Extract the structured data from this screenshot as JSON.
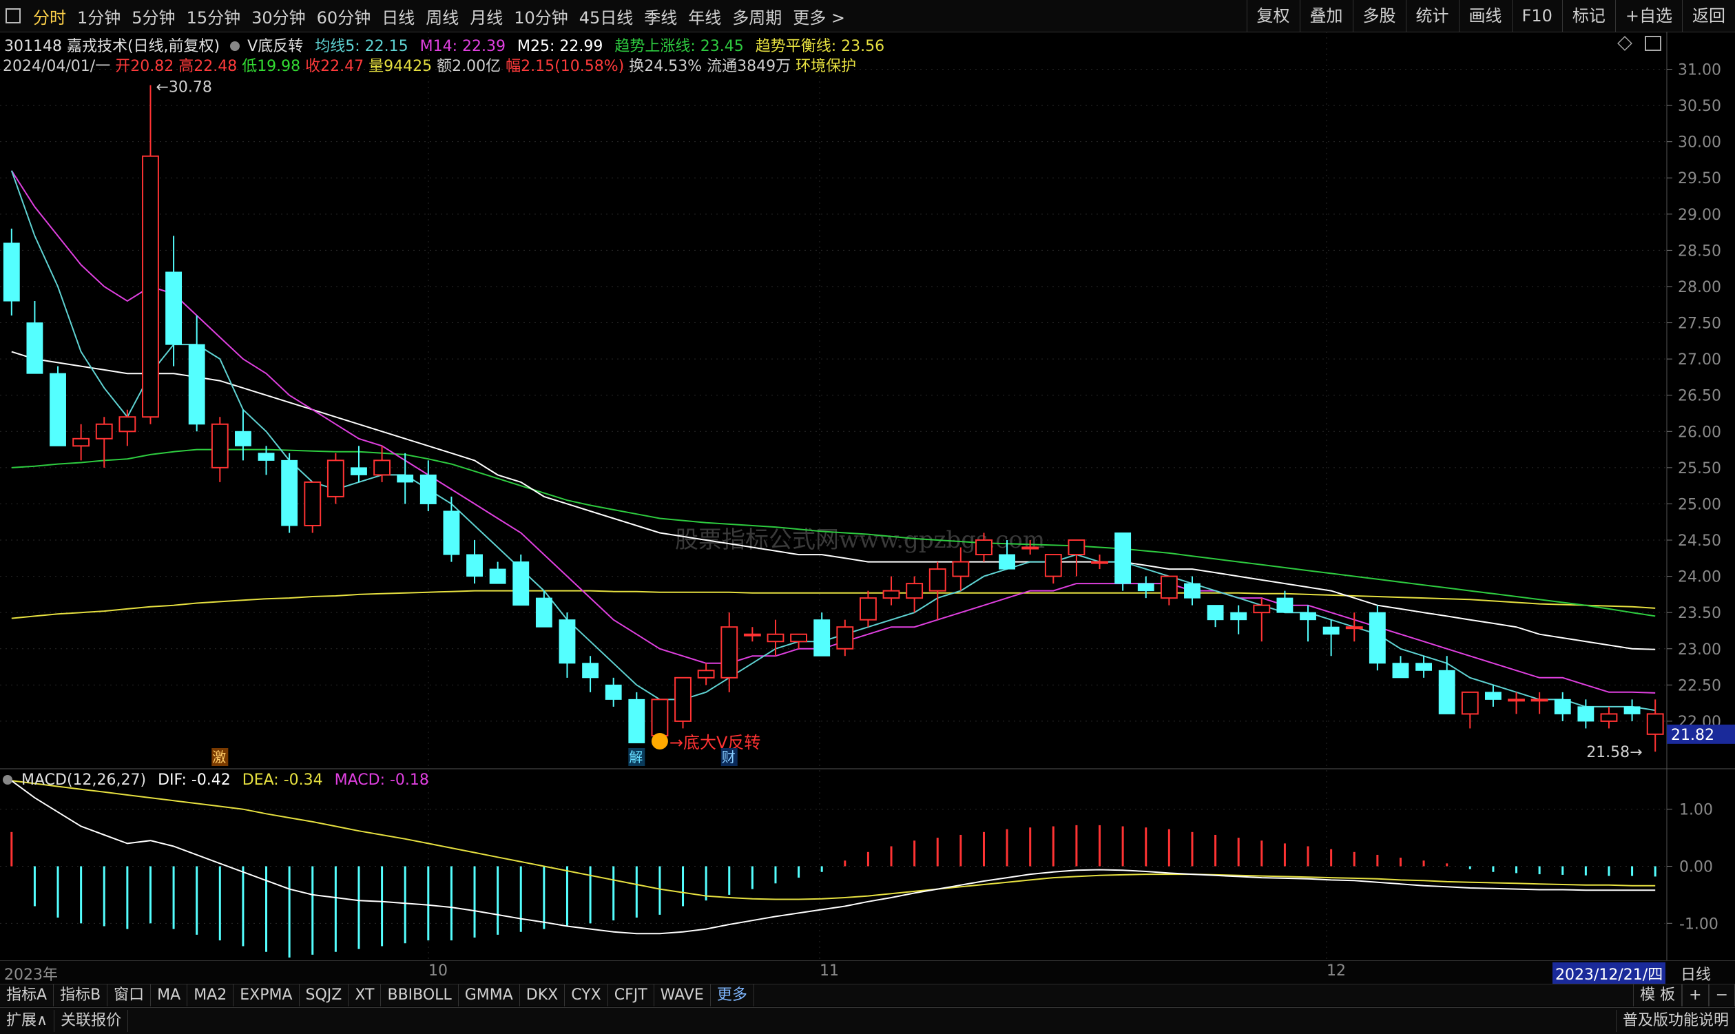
{
  "toolbar": {
    "periods": [
      "分时",
      "1分钟",
      "5分钟",
      "15分钟",
      "30分钟",
      "60分钟",
      "日线",
      "周线",
      "月线",
      "10分钟",
      "45日线",
      "季线",
      "年线",
      "多周期",
      "更多 >"
    ],
    "active_period": "分时",
    "right_buttons": [
      "复权",
      "叠加",
      "多股",
      "统计",
      "画线",
      "F10",
      "标记",
      "+自选",
      "返回"
    ]
  },
  "header": {
    "code_name": "301148 嘉戎技术(日线,前复权)",
    "indicator": "V底反转",
    "ma5": "均线5: 22.15",
    "m14": "M14: 22.39",
    "m25": "M25: 22.99",
    "trend_up": "趋势上涨线: 23.45",
    "trend_bal": "趋势平衡线: 23.56"
  },
  "stats": {
    "date": "2024/04/01/一",
    "open": "开20.82",
    "high": "高22.48",
    "low": "低19.98",
    "close": "收22.47",
    "volume": "量94425",
    "amount": "额2.00亿",
    "change": "幅2.15(10.58%)",
    "turnover": "换24.53%",
    "float": "流通3849万",
    "env": "环境保护"
  },
  "colors": {
    "up": "#ff3333",
    "down": "#54ffff",
    "ma5": "#5fd3d3",
    "m14": "#e040e0",
    "m25": "#ffffff",
    "trend_up": "#2ecc40",
    "trend_bal": "#e6e040",
    "dif": "#ffffff",
    "dea": "#e6e040"
  },
  "annotations": {
    "high_label": "30.78",
    "low_label": "21.58",
    "last_price": "21.82",
    "signal": "→底大V反转",
    "tag_ji": "激",
    "tag_jie": "解",
    "tag_cai": "财",
    "watermark": "股票指标公式网www.gpzbgs.com"
  },
  "macd": {
    "title": "MACD(12,26,27)",
    "dif": "DIF: -0.42",
    "dea": "DEA: -0.34",
    "macd": "MACD: -0.18"
  },
  "time_axis": {
    "labels": [
      "2023年",
      "10",
      "11",
      "12"
    ],
    "current": "2023/12/21/四",
    "period": "日线"
  },
  "bottom_tabs": [
    "指标A",
    "指标B",
    "窗口",
    "MA",
    "MA2",
    "EXPMA",
    "SQJZ",
    "XT",
    "BBIBOLL",
    "GMMA",
    "DKX",
    "CYX",
    "CFJT",
    "WAVE",
    "更多"
  ],
  "bottom_right": [
    "模 板",
    "+",
    "−"
  ],
  "footer": {
    "expand": "扩展∧",
    "quote": "关联报价",
    "right": "普及版功能说明"
  },
  "chart_data": {
    "type": "candlestick",
    "price_ticks": [
      "31.00",
      "30.50",
      "30.00",
      "29.50",
      "29.00",
      "28.50",
      "28.00",
      "27.50",
      "27.00",
      "26.50",
      "26.00",
      "25.50",
      "25.00",
      "24.50",
      "24.00",
      "23.50",
      "23.00",
      "22.50",
      "22.00"
    ],
    "ylim": [
      21.4,
      31.1
    ],
    "macd_ticks": [
      "1.00",
      "0.00",
      "-1.00"
    ],
    "macd_ylim": [
      -1.6,
      1.6
    ],
    "ohlc": [
      [
        28.6,
        28.8,
        27.6,
        27.8
      ],
      [
        27.5,
        27.8,
        26.8,
        26.8
      ],
      [
        26.8,
        26.9,
        25.8,
        25.8
      ],
      [
        25.8,
        26.1,
        25.6,
        25.9
      ],
      [
        25.9,
        26.2,
        25.5,
        26.1
      ],
      [
        26.0,
        26.3,
        25.8,
        26.2
      ],
      [
        26.2,
        30.78,
        26.1,
        29.8
      ],
      [
        28.2,
        28.7,
        26.9,
        27.2
      ],
      [
        27.2,
        27.6,
        26.0,
        26.1
      ],
      [
        25.5,
        26.2,
        25.3,
        26.1
      ],
      [
        26.0,
        26.3,
        25.6,
        25.8
      ],
      [
        25.7,
        25.8,
        25.4,
        25.6
      ],
      [
        25.6,
        25.7,
        24.6,
        24.7
      ],
      [
        24.7,
        25.3,
        24.6,
        25.3
      ],
      [
        25.1,
        25.7,
        25.0,
        25.6
      ],
      [
        25.5,
        25.8,
        25.3,
        25.4
      ],
      [
        25.4,
        25.8,
        25.3,
        25.6
      ],
      [
        25.4,
        25.7,
        25.0,
        25.3
      ],
      [
        25.4,
        25.6,
        24.9,
        25.0
      ],
      [
        24.9,
        25.1,
        24.2,
        24.3
      ],
      [
        24.3,
        24.5,
        23.9,
        24.0
      ],
      [
        24.1,
        24.2,
        23.9,
        23.9
      ],
      [
        24.2,
        24.3,
        23.6,
        23.6
      ],
      [
        23.7,
        23.8,
        23.3,
        23.3
      ],
      [
        23.4,
        23.5,
        22.6,
        22.8
      ],
      [
        22.8,
        22.9,
        22.4,
        22.6
      ],
      [
        22.5,
        22.6,
        22.2,
        22.3
      ],
      [
        22.3,
        22.4,
        21.7,
        21.7
      ],
      [
        21.8,
        22.3,
        21.8,
        22.3
      ],
      [
        22.0,
        22.6,
        21.9,
        22.6
      ],
      [
        22.6,
        22.8,
        22.5,
        22.7
      ],
      [
        22.6,
        23.5,
        22.4,
        23.3
      ],
      [
        23.2,
        23.3,
        23.1,
        23.2
      ],
      [
        23.1,
        23.4,
        22.9,
        23.2
      ],
      [
        23.1,
        23.2,
        23.0,
        23.2
      ],
      [
        23.4,
        23.5,
        22.9,
        22.9
      ],
      [
        23.0,
        23.4,
        22.9,
        23.3
      ],
      [
        23.4,
        23.8,
        23.3,
        23.7
      ],
      [
        23.7,
        24.0,
        23.6,
        23.8
      ],
      [
        23.7,
        24.0,
        23.5,
        23.9
      ],
      [
        23.8,
        24.2,
        23.4,
        24.1
      ],
      [
        24.0,
        24.4,
        23.8,
        24.2
      ],
      [
        24.3,
        24.6,
        24.2,
        24.5
      ],
      [
        24.3,
        24.5,
        24.1,
        24.1
      ],
      [
        24.4,
        24.5,
        24.3,
        24.4
      ],
      [
        24.0,
        24.2,
        23.9,
        24.3
      ],
      [
        24.3,
        24.5,
        24.0,
        24.5
      ],
      [
        24.2,
        24.3,
        24.1,
        24.2
      ],
      [
        24.6,
        24.6,
        23.8,
        23.9
      ],
      [
        23.9,
        24.0,
        23.7,
        23.8
      ],
      [
        23.7,
        24.0,
        23.6,
        24.0
      ],
      [
        23.9,
        24.0,
        23.6,
        23.7
      ],
      [
        23.6,
        23.6,
        23.3,
        23.4
      ],
      [
        23.5,
        23.6,
        23.2,
        23.4
      ],
      [
        23.5,
        23.7,
        23.1,
        23.6
      ],
      [
        23.7,
        23.8,
        23.5,
        23.5
      ],
      [
        23.5,
        23.6,
        23.1,
        23.4
      ],
      [
        23.3,
        23.4,
        22.9,
        23.2
      ],
      [
        23.3,
        23.5,
        23.1,
        23.3
      ],
      [
        23.5,
        23.6,
        22.7,
        22.8
      ],
      [
        22.8,
        22.9,
        22.6,
        22.6
      ],
      [
        22.8,
        22.9,
        22.6,
        22.7
      ],
      [
        22.7,
        22.9,
        22.1,
        22.1
      ],
      [
        22.1,
        22.4,
        21.9,
        22.4
      ],
      [
        22.4,
        22.5,
        22.2,
        22.3
      ],
      [
        22.3,
        22.4,
        22.1,
        22.3
      ],
      [
        22.3,
        22.4,
        22.1,
        22.3
      ],
      [
        22.3,
        22.4,
        22.0,
        22.1
      ],
      [
        22.2,
        22.3,
        21.9,
        22.0
      ],
      [
        22.0,
        22.2,
        21.9,
        22.1
      ],
      [
        22.2,
        22.3,
        22.0,
        22.1
      ],
      [
        21.82,
        22.3,
        21.58,
        22.1
      ]
    ],
    "ma5": [
      29.6,
      28.7,
      28.0,
      27.1,
      26.6,
      26.2,
      26.8,
      27.2,
      27.2,
      27.0,
      26.3,
      26.0,
      25.6,
      25.3,
      25.2,
      25.3,
      25.4,
      25.4,
      25.2,
      25.0,
      24.7,
      24.4,
      24.1,
      23.8,
      23.4,
      23.1,
      22.8,
      22.5,
      22.3,
      22.3,
      22.4,
      22.6,
      22.8,
      23.0,
      23.1,
      23.1,
      23.2,
      23.3,
      23.4,
      23.5,
      23.7,
      23.8,
      24.0,
      24.1,
      24.2,
      24.2,
      24.3,
      24.2,
      24.2,
      24.1,
      24.0,
      23.9,
      23.8,
      23.7,
      23.6,
      23.5,
      23.5,
      23.4,
      23.3,
      23.2,
      23.0,
      22.9,
      22.8,
      22.6,
      22.5,
      22.4,
      22.3,
      22.3,
      22.2,
      22.2,
      22.2,
      22.15
    ],
    "m14": [
      29.6,
      29.1,
      28.7,
      28.3,
      28.0,
      27.8,
      28.0,
      27.9,
      27.6,
      27.3,
      27.0,
      26.8,
      26.5,
      26.3,
      26.1,
      25.9,
      25.8,
      25.6,
      25.4,
      25.2,
      25.0,
      24.8,
      24.6,
      24.3,
      24.0,
      23.7,
      23.4,
      23.2,
      23.0,
      22.9,
      22.8,
      22.8,
      22.9,
      22.9,
      23.0,
      23.0,
      23.1,
      23.2,
      23.3,
      23.3,
      23.4,
      23.5,
      23.6,
      23.7,
      23.8,
      23.8,
      23.9,
      23.9,
      23.9,
      23.9,
      23.9,
      23.8,
      23.8,
      23.7,
      23.7,
      23.6,
      23.6,
      23.5,
      23.4,
      23.3,
      23.2,
      23.1,
      23.0,
      22.9,
      22.8,
      22.7,
      22.6,
      22.6,
      22.5,
      22.4,
      22.4,
      22.39
    ],
    "m25": [
      27.1,
      27.0,
      26.95,
      26.9,
      26.85,
      26.8,
      26.8,
      26.8,
      26.75,
      26.7,
      26.6,
      26.5,
      26.4,
      26.3,
      26.2,
      26.1,
      26.0,
      25.9,
      25.8,
      25.7,
      25.6,
      25.4,
      25.3,
      25.1,
      25.0,
      24.9,
      24.8,
      24.7,
      24.6,
      24.55,
      24.5,
      24.45,
      24.4,
      24.35,
      24.3,
      24.3,
      24.25,
      24.2,
      24.2,
      24.2,
      24.2,
      24.2,
      24.2,
      24.2,
      24.2,
      24.2,
      24.2,
      24.2,
      24.2,
      24.15,
      24.1,
      24.1,
      24.05,
      24.0,
      23.95,
      23.9,
      23.85,
      23.8,
      23.7,
      23.6,
      23.55,
      23.5,
      23.45,
      23.4,
      23.35,
      23.3,
      23.2,
      23.15,
      23.1,
      23.05,
      23.0,
      22.99
    ],
    "trend_up": [
      25.5,
      25.52,
      25.55,
      25.57,
      25.6,
      25.62,
      25.68,
      25.72,
      25.75,
      25.75,
      25.75,
      25.75,
      25.74,
      25.73,
      25.72,
      25.72,
      25.7,
      25.68,
      25.62,
      25.55,
      25.45,
      25.35,
      25.25,
      25.15,
      25.05,
      24.98,
      24.92,
      24.86,
      24.8,
      24.77,
      24.74,
      24.72,
      24.7,
      24.68,
      24.65,
      24.62,
      24.6,
      24.58,
      24.55,
      24.52,
      24.5,
      24.48,
      24.46,
      24.45,
      24.44,
      24.43,
      24.42,
      24.4,
      24.38,
      24.35,
      24.32,
      24.28,
      24.24,
      24.2,
      24.16,
      24.12,
      24.08,
      24.04,
      24.0,
      23.96,
      23.92,
      23.88,
      23.84,
      23.8,
      23.76,
      23.72,
      23.68,
      23.64,
      23.6,
      23.55,
      23.5,
      23.45
    ],
    "trend_bal": [
      23.42,
      23.45,
      23.48,
      23.5,
      23.52,
      23.55,
      23.58,
      23.6,
      23.63,
      23.65,
      23.67,
      23.69,
      23.7,
      23.72,
      23.73,
      23.75,
      23.76,
      23.77,
      23.78,
      23.79,
      23.8,
      23.8,
      23.8,
      23.8,
      23.8,
      23.8,
      23.79,
      23.79,
      23.78,
      23.78,
      23.78,
      23.78,
      23.77,
      23.77,
      23.77,
      23.77,
      23.77,
      23.77,
      23.77,
      23.77,
      23.77,
      23.77,
      23.77,
      23.77,
      23.77,
      23.77,
      23.77,
      23.77,
      23.77,
      23.77,
      23.77,
      23.77,
      23.77,
      23.77,
      23.76,
      23.76,
      23.75,
      23.74,
      23.73,
      23.72,
      23.71,
      23.7,
      23.69,
      23.68,
      23.66,
      23.64,
      23.62,
      23.61,
      23.6,
      23.59,
      23.58,
      23.56
    ],
    "macd_hist": [
      0.6,
      -0.7,
      -0.9,
      -1.0,
      -1.05,
      -1.1,
      -1.0,
      -1.1,
      -1.2,
      -1.3,
      -1.4,
      -1.5,
      -1.6,
      -1.55,
      -1.5,
      -1.45,
      -1.4,
      -1.35,
      -1.3,
      -1.3,
      -1.25,
      -1.2,
      -1.15,
      -1.1,
      -1.05,
      -1.0,
      -0.95,
      -0.9,
      -0.85,
      -0.7,
      -0.6,
      -0.5,
      -0.4,
      -0.3,
      -0.2,
      -0.1,
      0.1,
      0.25,
      0.35,
      0.45,
      0.5,
      0.55,
      0.6,
      0.65,
      0.68,
      0.7,
      0.72,
      0.72,
      0.7,
      0.68,
      0.65,
      0.6,
      0.55,
      0.5,
      0.45,
      0.4,
      0.35,
      0.3,
      0.25,
      0.2,
      0.15,
      0.1,
      0.05,
      -0.05,
      -0.1,
      -0.12,
      -0.14,
      -0.15,
      -0.16,
      -0.17,
      -0.17,
      -0.18
    ],
    "dif": [
      1.5,
      1.2,
      0.95,
      0.7,
      0.55,
      0.4,
      0.45,
      0.35,
      0.2,
      0.05,
      -0.1,
      -0.25,
      -0.4,
      -0.5,
      -0.55,
      -0.6,
      -0.62,
      -0.65,
      -0.68,
      -0.72,
      -0.78,
      -0.85,
      -0.92,
      -0.98,
      -1.05,
      -1.1,
      -1.15,
      -1.18,
      -1.18,
      -1.15,
      -1.1,
      -1.02,
      -0.95,
      -0.88,
      -0.82,
      -0.76,
      -0.7,
      -0.62,
      -0.55,
      -0.47,
      -0.4,
      -0.33,
      -0.26,
      -0.2,
      -0.14,
      -0.1,
      -0.07,
      -0.06,
      -0.07,
      -0.09,
      -0.12,
      -0.14,
      -0.16,
      -0.18,
      -0.2,
      -0.21,
      -0.22,
      -0.24,
      -0.25,
      -0.28,
      -0.31,
      -0.34,
      -0.36,
      -0.38,
      -0.39,
      -0.4,
      -0.41,
      -0.41,
      -0.42,
      -0.42,
      -0.42,
      -0.42
    ],
    "dea": [
      1.5,
      1.45,
      1.4,
      1.35,
      1.3,
      1.25,
      1.2,
      1.15,
      1.1,
      1.05,
      1.0,
      0.92,
      0.85,
      0.78,
      0.7,
      0.62,
      0.55,
      0.48,
      0.4,
      0.32,
      0.24,
      0.16,
      0.08,
      0.0,
      -0.08,
      -0.16,
      -0.24,
      -0.32,
      -0.4,
      -0.46,
      -0.52,
      -0.55,
      -0.57,
      -0.58,
      -0.58,
      -0.57,
      -0.55,
      -0.52,
      -0.48,
      -0.44,
      -0.4,
      -0.36,
      -0.32,
      -0.28,
      -0.24,
      -0.2,
      -0.18,
      -0.16,
      -0.15,
      -0.14,
      -0.14,
      -0.14,
      -0.15,
      -0.16,
      -0.17,
      -0.18,
      -0.19,
      -0.2,
      -0.21,
      -0.22,
      -0.24,
      -0.25,
      -0.27,
      -0.28,
      -0.29,
      -0.3,
      -0.31,
      -0.32,
      -0.33,
      -0.33,
      -0.34,
      -0.34
    ]
  }
}
